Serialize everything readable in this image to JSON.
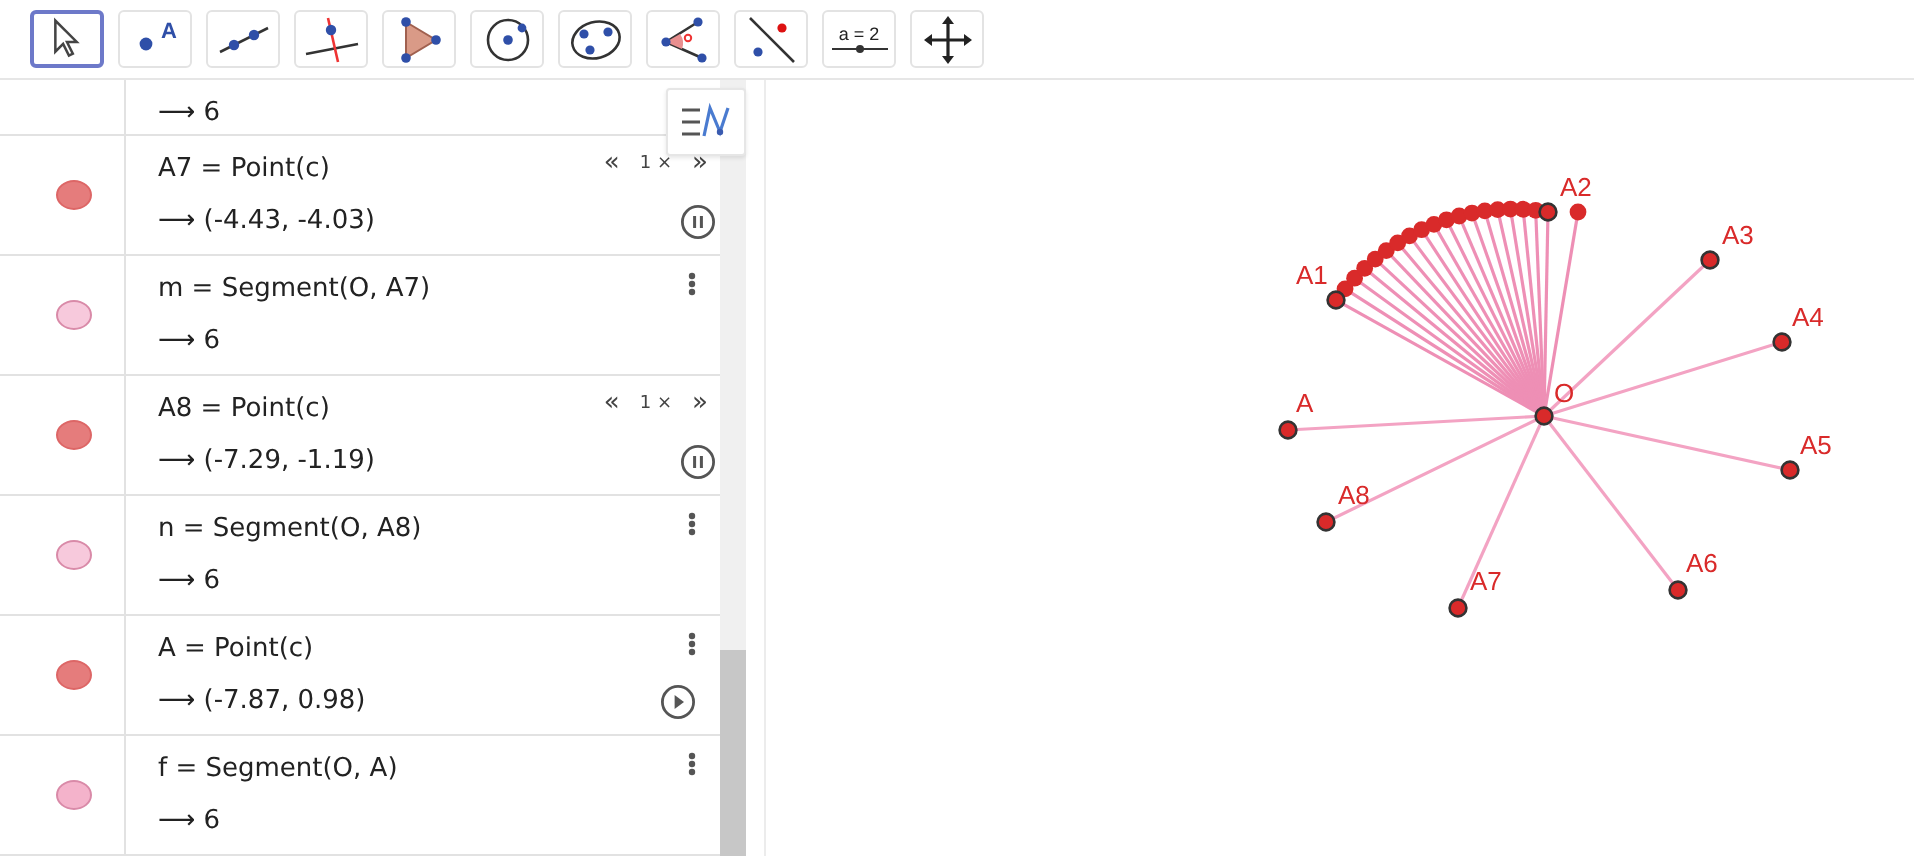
{
  "toolbar": {
    "tools": [
      {
        "kind": "move",
        "selected": true
      },
      {
        "kind": "point",
        "label": "A",
        "selected": false
      },
      {
        "kind": "line",
        "selected": false
      },
      {
        "kind": "perpendicular",
        "selected": false
      },
      {
        "kind": "polygon",
        "selected": false
      },
      {
        "kind": "circle",
        "selected": false
      },
      {
        "kind": "conic",
        "selected": false
      },
      {
        "kind": "angle",
        "selected": false
      },
      {
        "kind": "reflect",
        "selected": false
      },
      {
        "kind": "slider",
        "label": "a = 2",
        "selected": false
      },
      {
        "kind": "move-view",
        "selected": false
      }
    ]
  },
  "algebra": {
    "rows": [
      {
        "value": "⟶ 6"
      },
      {
        "kind": "point",
        "color": "#e57c7c",
        "definition": "A7 = Point(c)",
        "value": "⟶ (-4.43, -4.03)",
        "animating": true,
        "slower": "«",
        "speed": "1 ×",
        "faster": "»"
      },
      {
        "kind": "segment",
        "color": "#f7c9dc",
        "definition": "m = Segment(O, A7)",
        "value": "⟶ 6"
      },
      {
        "kind": "point",
        "color": "#e57c7c",
        "definition": "A8 = Point(c)",
        "value": "⟶ (-7.29, -1.19)",
        "animating": true,
        "slower": "«",
        "speed": "1 ×",
        "faster": "»"
      },
      {
        "kind": "segment",
        "color": "#f7c9dc",
        "definition": "n = Segment(O, A8)",
        "value": "⟶ 6"
      },
      {
        "kind": "point",
        "color": "#e57c7c",
        "definition": "A = Point(c)",
        "value": "⟶ (-7.87, 0.98)",
        "animating": false
      },
      {
        "kind": "segment",
        "color": "#f4b3cb",
        "definition": "f = Segment(O, A)",
        "value": "⟶ 6"
      }
    ]
  },
  "graphics": {
    "center_label": "O",
    "points": [
      {
        "label": "A1"
      },
      {
        "label": "A2"
      },
      {
        "label": "A3"
      },
      {
        "label": "A4"
      },
      {
        "label": "A5"
      },
      {
        "label": "A6"
      },
      {
        "label": "A7"
      },
      {
        "label": "A8"
      },
      {
        "label": "A"
      }
    ]
  }
}
